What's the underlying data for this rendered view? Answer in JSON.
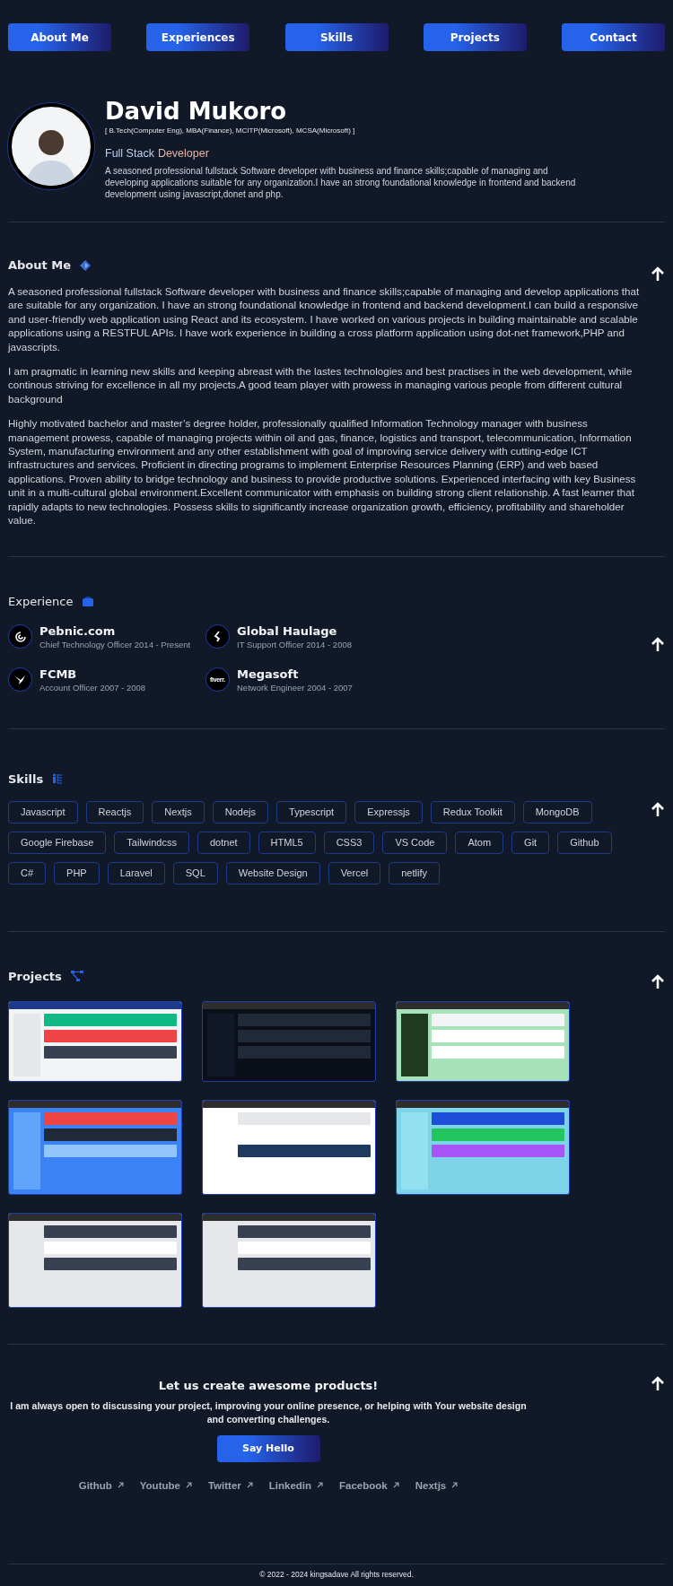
{
  "nav": [
    {
      "label": "About Me"
    },
    {
      "label": "Experiences"
    },
    {
      "label": "Skills"
    },
    {
      "label": "Projects"
    },
    {
      "label": "Contact"
    }
  ],
  "hero": {
    "name": "David Mukoro",
    "credentials": "[ B.Tech(Computer Eng), MBA(Finance), MCITP(Microsoft), MCSA(Microsoft) ]",
    "role_first": "Full Stack",
    "role_second": "Developer",
    "summary": "A seasoned professional fullstack Software developer with business and finance skills;capable of managing and developing applications suitable for any organization.I have an strong foundational knowledge in frontend and backend development using javascript,donet and php."
  },
  "about": {
    "title": "About Me",
    "paragraphs": [
      "A seasoned professional fullstack Software developer with business and finance skills;capable of managing and develop applications that are suitable for any organization. I have an strong foundational knowledge in frontend and backend development.I can build a responsive and user-friendly web application using React and its ecosystem. I have worked on various projects in building maintainable and scalable applications using a RESTFUL APIs. I have work experience in building a cross platform application using dot-net framework,PHP and javascripts.",
      "I am pragmatic in learning new skills and keeping abreast with the lastes technologies and best practises in the web development, while continous striving for excellence in all my projects.A good team player with prowess in managing various people from different cultural background",
      "Highly motivated bachelor and master’s degree holder, professionally qualified Information Technology manager with business management prowess, capable of managing projects within oil and gas, finance, logistics and transport, telecommunication, Information System, manufacturing environment and any other establishment with goal of improving service delivery with cutting-edge ICT infrastructures and services. Proficient in directing programs to implement Enterprise Resources Planning (ERP) and web based applications. Proven ability to bridge technology and business to provide productive solutions. Experienced interfacing with key Business unit in a multi-cultural global environment.Excellent communicator with emphasis on building strong client relationship. A fast learner that rapidly adapts to new technologies. Possess skills to significantly increase organization growth, efficiency, profitability and shareholder value."
    ]
  },
  "experience": {
    "title": "Experience",
    "items": [
      {
        "company": "Pebnic.com",
        "role": "Chief Technology Officer 2014 - Present",
        "kind": "swirl"
      },
      {
        "company": "Global Haulage",
        "role": "IT Support Officer 2014 - 2008",
        "kind": "chevron"
      },
      {
        "company": "FCMB",
        "role": "Account Officer 2007 - 2008",
        "kind": "bird"
      },
      {
        "company": "Megasoft",
        "role": "Network Engineer 2004 - 2007",
        "kind": "wordmark",
        "logo_text": "fiverr."
      }
    ]
  },
  "skills": {
    "title": "Skills",
    "items": [
      "Javascript",
      "Reactjs",
      "Nextjs",
      "Nodejs",
      "Typescript",
      "Expressjs",
      "Redux Toolkit",
      "MongoDB",
      "Google Firebase",
      "Tailwindcss",
      "dotnet",
      "HTML5",
      "CSS3",
      "VS Code",
      "Atom",
      "Git",
      "Github",
      "C#",
      "PHP",
      "Laravel",
      "SQL",
      "Website Design",
      "Vercel",
      "netlify"
    ]
  },
  "projects": {
    "title": "Projects",
    "items": [
      {
        "kind": "light"
      },
      {
        "kind": "dark"
      },
      {
        "kind": "green"
      },
      {
        "kind": "illustration"
      },
      {
        "kind": "form"
      },
      {
        "kind": "colorful"
      },
      {
        "kind": "plain"
      },
      {
        "kind": "plain"
      }
    ]
  },
  "contact": {
    "title": "Let us create awesome products!",
    "text": "I am always open to discussing your project, improving your online presence, or helping with Your website design and converting challenges.",
    "button": "Say Hello",
    "links": [
      "Github",
      "Youtube",
      "Twitter",
      "Linkedin",
      "Facebook",
      "Nextjs"
    ]
  },
  "footer": {
    "copyright": "© 2022 - 2024 kingsadave All rights reserved."
  }
}
